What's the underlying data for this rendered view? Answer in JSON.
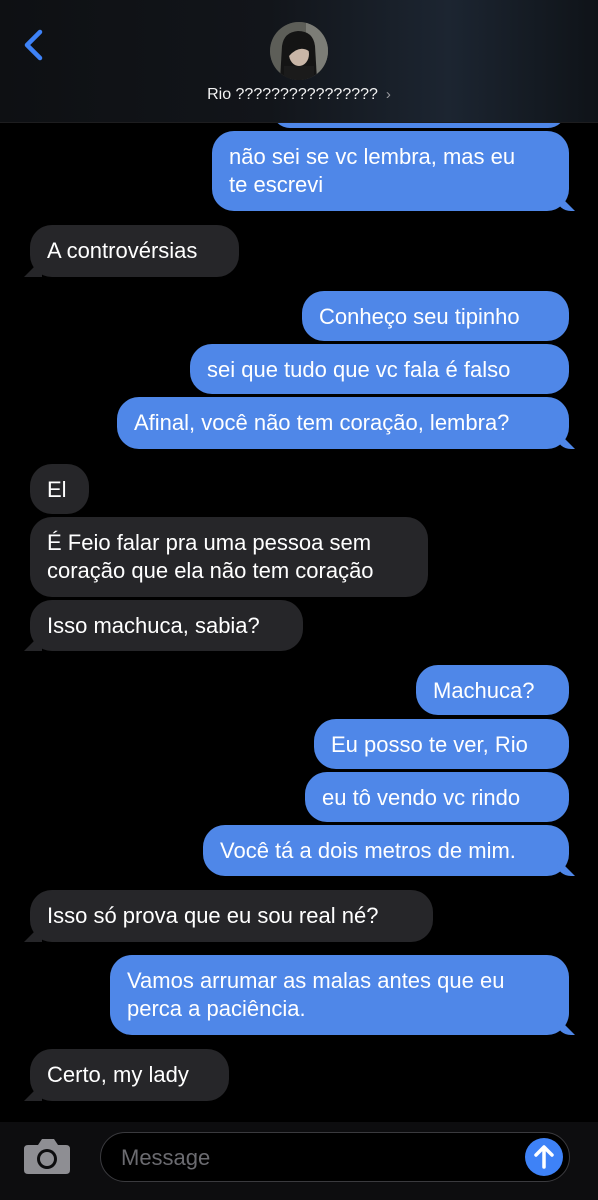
{
  "header": {
    "contact_name": "Rio ????????????????",
    "chevron": "›",
    "back_icon": "chevron-left-icon",
    "avatar_icon": "contact-avatar"
  },
  "messages": [
    {
      "side": "out",
      "text": "não sei se vc lembra, mas eu\nte escrevi"
    },
    {
      "side": "in",
      "text": "A controvérsias"
    },
    {
      "side": "out",
      "text": "Conheço seu tipinho"
    },
    {
      "side": "out",
      "text": "sei que tudo que vc fala é falso"
    },
    {
      "side": "out",
      "text": "Afinal, você não tem coração, lembra?"
    },
    {
      "side": "in",
      "text": "El"
    },
    {
      "side": "in",
      "text": "É Feio falar pra uma pessoa sem\ncoração que ela não tem coração"
    },
    {
      "side": "in",
      "text": "Isso machuca, sabia?"
    },
    {
      "side": "out",
      "text": "Machuca?"
    },
    {
      "side": "out",
      "text": "Eu posso te ver, Rio"
    },
    {
      "side": "out",
      "text": "eu tô vendo vc rindo"
    },
    {
      "side": "out",
      "text": "Você tá a dois metros de mim."
    },
    {
      "side": "in",
      "text": "Isso só prova que eu sou real né?"
    },
    {
      "side": "out",
      "text": "Vamos arrumar as malas antes que eu\nperca a paciência."
    },
    {
      "side": "in",
      "text": "Certo, my lady"
    }
  ],
  "composer": {
    "placeholder": "Message",
    "camera_icon": "camera-icon",
    "send_icon": "arrow-up-icon"
  },
  "colors": {
    "outgoing": "#4f87e8",
    "incoming": "#262629",
    "accent": "#3e82f7"
  }
}
